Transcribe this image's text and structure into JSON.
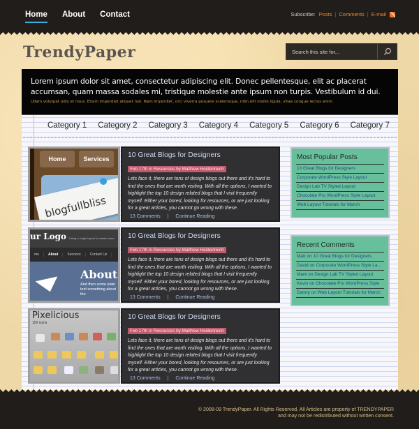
{
  "nav": {
    "items": [
      {
        "label": "Home",
        "active": true
      },
      {
        "label": "About",
        "active": false
      },
      {
        "label": "Contact",
        "active": false
      }
    ]
  },
  "subscribe": {
    "label": "Subscribe:",
    "links": [
      "Posts",
      "Comments",
      "E-mail"
    ],
    "icon": "rss-icon"
  },
  "site": {
    "logo": "TrendyPaper"
  },
  "search": {
    "placeholder": "Search this site for...",
    "icon": "search-icon"
  },
  "intro": {
    "lead": "Lorem ipsum dolor sit amet, consectetur adipiscing elit. Donec pellentesque, elit ac placerat accumsan, quam massa sodales mi, tristique molestie ante ipsum non turpis. Vestibulum id dui.",
    "sub": "Ullam volutpat odio et risus. Etiam imperdiet aliquet nisl. Nam imperdiet, orci viverra posuere scelerisque, nibh elit mollis ligula, vitae congue lectus enim."
  },
  "categories": [
    "Category 1",
    "Category 2",
    "Category 3",
    "Category 4",
    "Category 5",
    "Category 6",
    "Category 7"
  ],
  "posts": [
    {
      "title": "10 Great Blogs for Designers",
      "meta": "Feb 17th in Resources by Matthew Heidenreich",
      "excerpt": "Lets face it, there are tons of design blogs out there and it's hard to find the ones that are worth visiting. With all the options, I wanted to highlight the top 10 design related blogs that I visit frequently myself. Either your bored, looking for resources, or are just looking for a great articles, you cannot go wrong with these.",
      "comments": "13 Comments",
      "separator": "|",
      "more": "Continue Reading",
      "thumb": {
        "tabs": [
          "Home",
          "Services"
        ],
        "brand": "blogfullbliss"
      }
    },
    {
      "title": "10 Great Blogs for Designers",
      "meta": "Feb 17th in Resources by Matthew Heidenreich",
      "excerpt": "Lets face it, there are tons of design blogs out there and it's hard to find the ones that are worth visiting. With all the options, I wanted to highlight the top 10 design related blogs that I visit frequently myself. Either your bored, looking for resources, or are just looking for a great articles, you cannot go wrong with these.",
      "comments": "13 Comments",
      "separator": "|",
      "more": "Continue Reading",
      "thumb": {
        "logo": "ur Logo",
        "tagline": "Using a single layout to create some",
        "menu": [
          "me",
          "About",
          "Services",
          "Contact Us"
        ],
        "heading": "About",
        "text": "And then some plain text something about the"
      }
    },
    {
      "title": "10 Great Blogs for Designers",
      "meta": "Feb 17th in Resources by Matthew Heidenreich",
      "excerpt": "Lets face it, there are tons of design blogs out there and it's hard to find the ones that are worth visiting. With all the options, I wanted to highlight the top 10 design related blogs that I visit frequently myself. Either your bored, looking for resources, or are just looking for a great articles, you cannot go wrong with these.",
      "comments": "13 Comments",
      "separator": "|",
      "more": "Continue Reading",
      "thumb": {
        "title": "Pixelicious",
        "count": "150 icons"
      }
    }
  ],
  "sidebar": {
    "popular": {
      "title": "Most Popular Posts",
      "items": [
        "10 Great Blogs for Designers",
        "Corporate WordPress Style Layout",
        "Design Lab TV Styled Layout",
        "Chocolate Pro WordPress Style Layout",
        "Web Layout Tutorials for March"
      ]
    },
    "recent": {
      "title": "Recent Comments",
      "items": [
        "Matt on 10 Great Blogs for Designers",
        "David on Corporate WordPress Style La...",
        "Mark on Design Lab TV Styled Layout",
        "Kevin on Chocolate Pro WordPress Style",
        "Danny on Web Layout Tutorials for March"
      ]
    }
  },
  "footer": {
    "line1": "© 2008-09 TrendyPaper. All Rights Reserved. All Articles are property of TRENDYPAPER",
    "line2": "and may not be redistributed without written consent."
  },
  "colors": {
    "nav_active_underline": "#35b0e0",
    "subscribe_link": "#e88b2c",
    "meta_badge": "#c05a6c",
    "widget_bg": "#68bf9b",
    "widget_link": "#1d4c82",
    "dark_bg": "#211d1a"
  }
}
